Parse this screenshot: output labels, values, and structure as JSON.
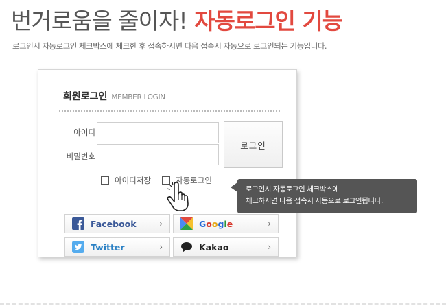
{
  "headline": {
    "plain": "번거로움을 줄이자!",
    "accent": "자동로그인 기능"
  },
  "subline": "로그인시 자동로그인 체크박스에 체크한 후 접속하시면 다음 접속시 자동으로 로그인되는 기능입니다.",
  "login": {
    "title": "회원로그인",
    "title_en": "MEMBER LOGIN",
    "id_label": "아이디",
    "pw_label": "비밀번호",
    "id_value": "",
    "pw_value": "",
    "button": "로그인",
    "save_id": "아이디저장",
    "auto_login": "자동로그인"
  },
  "tooltip": {
    "line1": "로그인시 자동로그인 체크박스에",
    "line2": "체크하시면 다음 접속시 자동으로 로그인됩니다."
  },
  "social": {
    "facebook": "Facebook",
    "google": [
      "G",
      "o",
      "o",
      "g",
      "l",
      "e"
    ],
    "twitter": "Twitter",
    "kakao": "Kakao"
  },
  "colors": {
    "accent": "#e2493f",
    "tooltip_bg": "#555555"
  }
}
